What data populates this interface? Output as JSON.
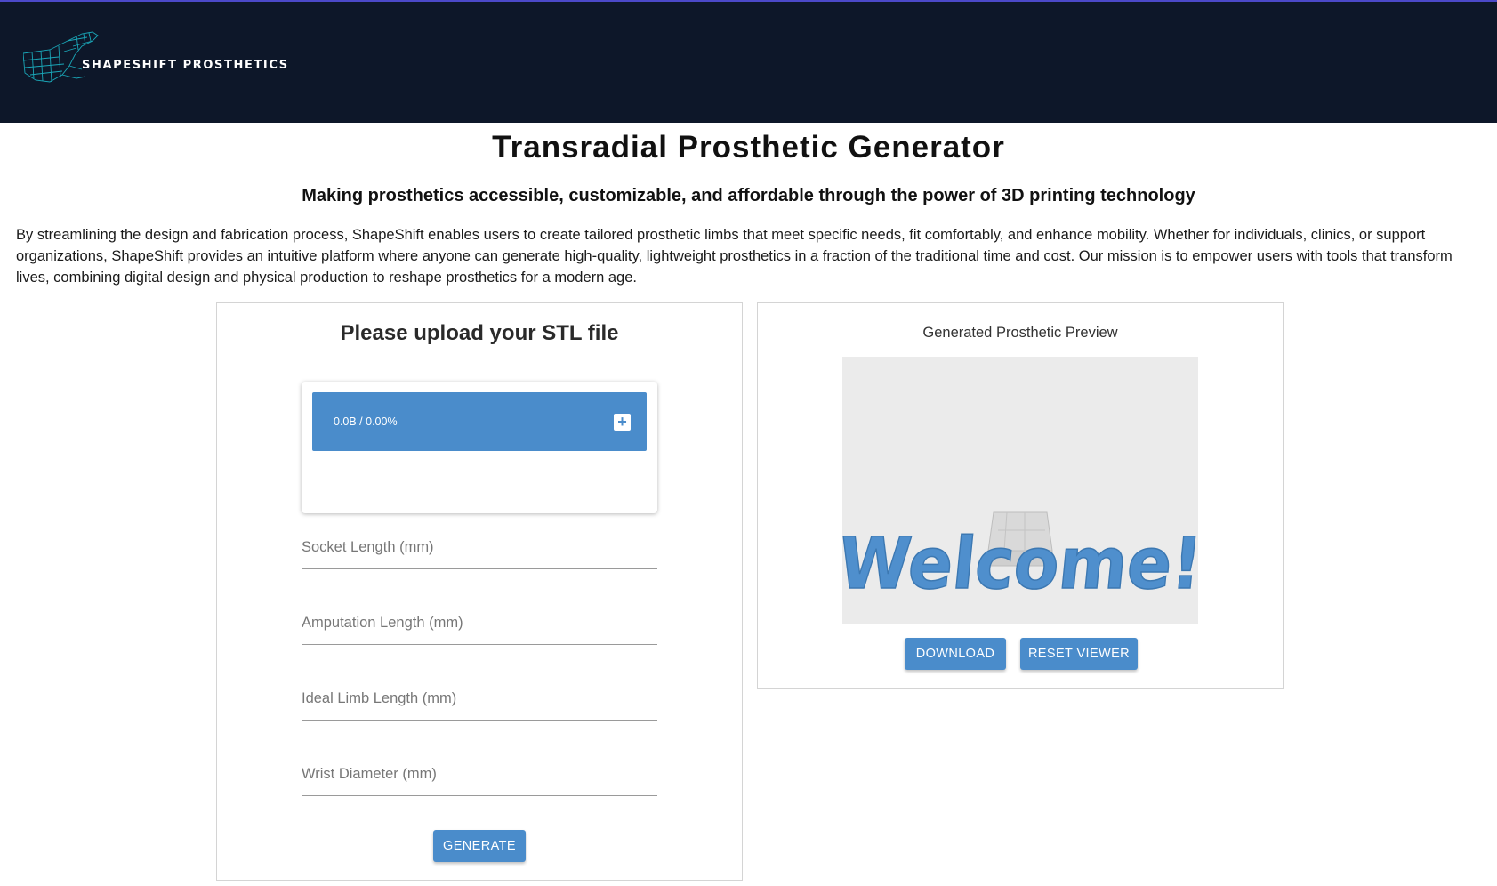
{
  "header": {
    "brand_name": "SHAPESHIFT PROSTHETICS",
    "logo_icon": "wireframe-hand-icon",
    "background_color": "#0d1729"
  },
  "page": {
    "title": "Transradial Prosthetic Generator",
    "subtitle": "Making prosthetics accessible, customizable, and affordable through the power of 3D printing technology",
    "intro": "By streamlining the design and fabrication process, ShapeShift enables users to create tailored prosthetic limbs that meet specific needs, fit comfortably, and enhance mobility. Whether for individuals, clinics, or support organizations, ShapeShift provides an intuitive platform where anyone can generate high-quality, lightweight prosthetics in a fraction of the traditional time and cost. Our mission is to empower users with tools that transform lives, combining digital design and physical production to reshape prosthetics for a modern age."
  },
  "upload": {
    "title": "Please upload your STL file",
    "progress_text": "0.0B / 0.00%",
    "add_icon": "plus-icon",
    "fields": [
      {
        "placeholder": "Socket Length (mm)",
        "value": ""
      },
      {
        "placeholder": "Amputation Length (mm)",
        "value": ""
      },
      {
        "placeholder": "Ideal Limb Length (mm)",
        "value": ""
      },
      {
        "placeholder": "Wrist Diameter (mm)",
        "value": ""
      }
    ],
    "generate_label": "GENERATE"
  },
  "preview": {
    "label": "Generated Prosthetic Preview",
    "viewer_text": "Welcome!",
    "download_label": "DOWNLOAD",
    "reset_label": "RESET VIEWER"
  },
  "colors": {
    "accent": "#4a8ccb",
    "viewer_background": "#ebebeb"
  }
}
